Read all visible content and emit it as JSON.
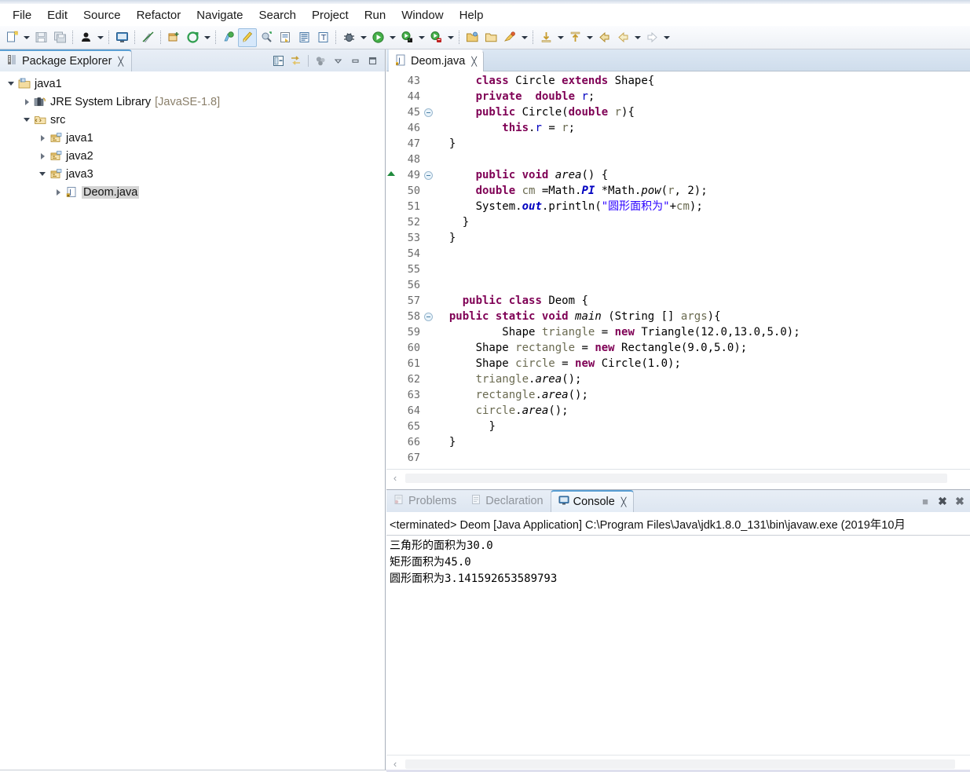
{
  "menu": {
    "items": [
      "File",
      "Edit",
      "Source",
      "Refactor",
      "Navigate",
      "Search",
      "Project",
      "Run",
      "Window",
      "Help"
    ]
  },
  "toolbar": {
    "groups": [
      {
        "buttons": [
          {
            "name": "new-wizard-icon",
            "label": "New",
            "dropdown": true
          },
          {
            "name": "save-icon",
            "label": "Save",
            "dropdown": false
          },
          {
            "name": "save-all-icon",
            "label": "Save All",
            "dropdown": false
          }
        ]
      },
      {
        "buttons": [
          {
            "name": "person-icon",
            "label": "Toggle Breakpoint",
            "dropdown": true
          }
        ]
      },
      {
        "buttons": [
          {
            "name": "console-icon",
            "label": "Open Console",
            "dropdown": false
          }
        ]
      },
      {
        "buttons": [
          {
            "name": "skip-breakpoints-icon",
            "label": "Skip All Breakpoints",
            "dropdown": false
          }
        ]
      },
      {
        "buttons": [
          {
            "name": "new-java-package-icon",
            "label": "New Java Package",
            "dropdown": false
          },
          {
            "name": "new-java-class-icon",
            "label": "New Java Class",
            "dropdown": true
          }
        ]
      },
      {
        "buttons": [
          {
            "name": "new-java-project-icon",
            "label": "New Java Project",
            "dropdown": false
          },
          {
            "name": "highlight-icon",
            "label": "Toggle Mark Occurrences",
            "dropdown": false,
            "active": true
          },
          {
            "name": "open-type-icon",
            "label": "Open Type",
            "dropdown": false
          },
          {
            "name": "externalize-strings-icon",
            "label": "Externalize Strings",
            "dropdown": false
          },
          {
            "name": "last-edit-icon",
            "label": "Last Edit Location",
            "dropdown": false
          },
          {
            "name": "next-annotation-icon",
            "label": "Next Annotation",
            "dropdown": false
          }
        ]
      },
      {
        "buttons": [
          {
            "name": "debug-icon",
            "label": "Debug",
            "dropdown": true
          },
          {
            "name": "run-icon",
            "label": "Run",
            "dropdown": true
          },
          {
            "name": "run-external-tools-icon",
            "label": "External Tools",
            "dropdown": true
          },
          {
            "name": "coverage-icon",
            "label": "Coverage",
            "dropdown": true
          }
        ]
      },
      {
        "buttons": [
          {
            "name": "open-folder-icon",
            "label": "Open Resource",
            "dropdown": false
          },
          {
            "name": "folder-icon",
            "label": "Open Task",
            "dropdown": false
          },
          {
            "name": "search-icon",
            "label": "Search",
            "dropdown": true
          }
        ]
      },
      {
        "buttons": [
          {
            "name": "previous-edit-icon",
            "label": "Previous Edit Location",
            "dropdown": true
          },
          {
            "name": "next-edit-icon",
            "label": "Next Edit Location",
            "dropdown": true
          },
          {
            "name": "back-icon",
            "label": "Back",
            "dropdown": false
          },
          {
            "name": "back-history-icon",
            "label": "Back History",
            "dropdown": true
          },
          {
            "name": "forward-icon",
            "label": "Forward",
            "dropdown": true
          }
        ]
      }
    ]
  },
  "explorer": {
    "title": "Package Explorer",
    "close_glyph": "╳",
    "tools": [
      {
        "name": "collapse-all-icon",
        "label": "Collapse All"
      },
      {
        "name": "link-with-editor-icon",
        "label": "Link with Editor"
      },
      {
        "name": "focus-on-active-task-icon",
        "label": "Focus on Active Task"
      },
      {
        "name": "view-menu-icon",
        "label": "View Menu"
      },
      {
        "name": "minimize-icon",
        "label": "Minimize"
      },
      {
        "name": "maximize-icon",
        "label": "Maximize"
      }
    ],
    "tree": [
      {
        "label": "java1",
        "suffix": "",
        "depth": 0,
        "state": "open",
        "icon": "java-project-icon",
        "selected": false
      },
      {
        "label": "JRE System Library",
        "suffix": "[JavaSE-1.8]",
        "depth": 1,
        "state": "closed",
        "icon": "jre-library-icon",
        "selected": false
      },
      {
        "label": "src",
        "suffix": "",
        "depth": 1,
        "state": "open",
        "icon": "source-folder-icon",
        "selected": false
      },
      {
        "label": "java1",
        "suffix": "",
        "depth": 2,
        "state": "closed",
        "icon": "package-icon",
        "selected": false
      },
      {
        "label": "java2",
        "suffix": "",
        "depth": 2,
        "state": "closed",
        "icon": "package-icon",
        "selected": false
      },
      {
        "label": "java3",
        "suffix": "",
        "depth": 2,
        "state": "open",
        "icon": "package-icon",
        "selected": false
      },
      {
        "label": "Deom.java",
        "suffix": "",
        "depth": 3,
        "state": "closed",
        "icon": "java-file-icon",
        "selected": true
      }
    ]
  },
  "editor": {
    "tab": {
      "label": "Deom.java",
      "icon": "java-file-icon",
      "close_glyph": "╳"
    },
    "first_line": 43,
    "lines": [
      {
        "no": 43,
        "fold": "",
        "marker": "",
        "indent": 3,
        "tokens": [
          {
            "t": "kw",
            "v": "class"
          },
          {
            "t": "pl",
            "v": " Circle "
          },
          {
            "t": "kw",
            "v": "extends"
          },
          {
            "t": "pl",
            "v": " Shape{"
          }
        ]
      },
      {
        "no": 44,
        "fold": "",
        "marker": "",
        "indent": 3,
        "tokens": [
          {
            "t": "kw",
            "v": "private"
          },
          {
            "t": "pl",
            "v": "  "
          },
          {
            "t": "kw",
            "v": "double"
          },
          {
            "t": "pl",
            "v": " "
          },
          {
            "t": "fld",
            "v": "r"
          },
          {
            "t": "pl",
            "v": ";"
          }
        ]
      },
      {
        "no": 45,
        "fold": "minus",
        "marker": "",
        "indent": 3,
        "tokens": [
          {
            "t": "kw",
            "v": "public"
          },
          {
            "t": "pl",
            "v": " Circle("
          },
          {
            "t": "kw",
            "v": "double"
          },
          {
            "t": "pl",
            "v": " "
          },
          {
            "t": "lv",
            "v": "r"
          },
          {
            "t": "pl",
            "v": "){"
          }
        ]
      },
      {
        "no": 46,
        "fold": "",
        "marker": "",
        "indent": 5,
        "tokens": [
          {
            "t": "kw",
            "v": "this"
          },
          {
            "t": "pl",
            "v": "."
          },
          {
            "t": "fld",
            "v": "r"
          },
          {
            "t": "pl",
            "v": " = "
          },
          {
            "t": "lv",
            "v": "r"
          },
          {
            "t": "pl",
            "v": ";"
          }
        ]
      },
      {
        "no": 47,
        "fold": "",
        "marker": "",
        "indent": 1,
        "tokens": [
          {
            "t": "pl",
            "v": "}"
          }
        ]
      },
      {
        "no": 48,
        "fold": "",
        "marker": "",
        "indent": 0,
        "tokens": []
      },
      {
        "no": 49,
        "fold": "minus",
        "marker": "up",
        "indent": 3,
        "tokens": [
          {
            "t": "kw",
            "v": "public"
          },
          {
            "t": "pl",
            "v": " "
          },
          {
            "t": "kw",
            "v": "void"
          },
          {
            "t": "pl",
            "v": " "
          },
          {
            "t": "mth",
            "v": "area"
          },
          {
            "t": "pl",
            "v": "() {"
          }
        ]
      },
      {
        "no": 50,
        "fold": "",
        "marker": "",
        "indent": 3,
        "tokens": [
          {
            "t": "kw",
            "v": "double"
          },
          {
            "t": "pl",
            "v": " "
          },
          {
            "t": "lv",
            "v": "cm"
          },
          {
            "t": "pl",
            "v": " =Math."
          },
          {
            "t": "sf",
            "v": "PI"
          },
          {
            "t": "pl",
            "v": " *Math."
          },
          {
            "t": "mth",
            "v": "pow"
          },
          {
            "t": "pl",
            "v": "("
          },
          {
            "t": "lv",
            "v": "r"
          },
          {
            "t": "pl",
            "v": ", 2);"
          }
        ]
      },
      {
        "no": 51,
        "fold": "",
        "marker": "",
        "indent": 3,
        "tokens": [
          {
            "t": "pl",
            "v": "System."
          },
          {
            "t": "sf",
            "v": "out"
          },
          {
            "t": "pl",
            "v": ".println("
          },
          {
            "t": "str",
            "v": "\"圆形面积为\""
          },
          {
            "t": "pl",
            "v": "+"
          },
          {
            "t": "lv",
            "v": "cm"
          },
          {
            "t": "pl",
            "v": ");"
          }
        ]
      },
      {
        "no": 52,
        "fold": "",
        "marker": "",
        "indent": 2,
        "tokens": [
          {
            "t": "pl",
            "v": "}"
          }
        ]
      },
      {
        "no": 53,
        "fold": "",
        "marker": "",
        "indent": 1,
        "tokens": [
          {
            "t": "pl",
            "v": "}"
          }
        ]
      },
      {
        "no": 54,
        "fold": "",
        "marker": "",
        "indent": 0,
        "tokens": []
      },
      {
        "no": 55,
        "fold": "",
        "marker": "",
        "indent": 0,
        "tokens": []
      },
      {
        "no": 56,
        "fold": "",
        "marker": "",
        "indent": 0,
        "tokens": []
      },
      {
        "no": 57,
        "fold": "",
        "marker": "",
        "indent": 2,
        "tokens": [
          {
            "t": "kw",
            "v": "public"
          },
          {
            "t": "pl",
            "v": " "
          },
          {
            "t": "kw",
            "v": "class"
          },
          {
            "t": "pl",
            "v": " Deom {"
          }
        ]
      },
      {
        "no": 58,
        "fold": "minus",
        "marker": "",
        "indent": 1,
        "tokens": [
          {
            "t": "kw",
            "v": "public"
          },
          {
            "t": "pl",
            "v": " "
          },
          {
            "t": "kw",
            "v": "static"
          },
          {
            "t": "pl",
            "v": " "
          },
          {
            "t": "kw",
            "v": "void"
          },
          {
            "t": "pl",
            "v": " "
          },
          {
            "t": "mth",
            "v": "main"
          },
          {
            "t": "pl",
            "v": " (String [] "
          },
          {
            "t": "lv",
            "v": "args"
          },
          {
            "t": "pl",
            "v": "){"
          }
        ]
      },
      {
        "no": 59,
        "fold": "",
        "marker": "",
        "indent": 5,
        "tokens": [
          {
            "t": "pl",
            "v": "Shape "
          },
          {
            "t": "lv",
            "v": "triangle"
          },
          {
            "t": "pl",
            "v": " = "
          },
          {
            "t": "kw",
            "v": "new"
          },
          {
            "t": "pl",
            "v": " Triangle(12.0,13.0,5.0);"
          }
        ]
      },
      {
        "no": 60,
        "fold": "",
        "marker": "",
        "indent": 3,
        "tokens": [
          {
            "t": "pl",
            "v": "Shape "
          },
          {
            "t": "lv",
            "v": "rectangle"
          },
          {
            "t": "pl",
            "v": " = "
          },
          {
            "t": "kw",
            "v": "new"
          },
          {
            "t": "pl",
            "v": " Rectangle(9.0,5.0);"
          }
        ]
      },
      {
        "no": 61,
        "fold": "",
        "marker": "",
        "indent": 3,
        "tokens": [
          {
            "t": "pl",
            "v": "Shape "
          },
          {
            "t": "lv",
            "v": "circle"
          },
          {
            "t": "pl",
            "v": " = "
          },
          {
            "t": "kw",
            "v": "new"
          },
          {
            "t": "pl",
            "v": " Circle(1.0);"
          }
        ]
      },
      {
        "no": 62,
        "fold": "",
        "marker": "",
        "indent": 3,
        "tokens": [
          {
            "t": "lv",
            "v": "triangle"
          },
          {
            "t": "pl",
            "v": "."
          },
          {
            "t": "mth",
            "v": "area"
          },
          {
            "t": "pl",
            "v": "();"
          }
        ]
      },
      {
        "no": 63,
        "fold": "",
        "marker": "",
        "indent": 3,
        "tokens": [
          {
            "t": "lv",
            "v": "rectangle"
          },
          {
            "t": "pl",
            "v": "."
          },
          {
            "t": "mth",
            "v": "area"
          },
          {
            "t": "pl",
            "v": "();"
          }
        ]
      },
      {
        "no": 64,
        "fold": "",
        "marker": "",
        "indent": 3,
        "tokens": [
          {
            "t": "lv",
            "v": "circle"
          },
          {
            "t": "pl",
            "v": "."
          },
          {
            "t": "mth",
            "v": "area"
          },
          {
            "t": "pl",
            "v": "();"
          }
        ]
      },
      {
        "no": 65,
        "fold": "",
        "marker": "",
        "indent": 4,
        "tokens": [
          {
            "t": "pl",
            "v": "}"
          }
        ]
      },
      {
        "no": 66,
        "fold": "",
        "marker": "",
        "indent": 1,
        "tokens": [
          {
            "t": "pl",
            "v": "}"
          }
        ]
      },
      {
        "no": 67,
        "fold": "",
        "marker": "",
        "indent": 0,
        "tokens": []
      }
    ]
  },
  "console": {
    "tabs": [
      {
        "label": "Problems",
        "icon": "problems-icon",
        "active": false,
        "closeable": false
      },
      {
        "label": "Declaration",
        "icon": "declaration-icon",
        "active": false,
        "closeable": false
      },
      {
        "label": "Console",
        "icon": "console-icon",
        "active": true,
        "closeable": true
      }
    ],
    "close_glyph": "╳",
    "tools": [
      {
        "name": "terminate-icon",
        "label": "Terminate",
        "glyph": "■"
      },
      {
        "name": "remove-launch-icon",
        "label": "Remove Launch",
        "glyph": "✖"
      },
      {
        "name": "remove-all-icon",
        "label": "Remove All Terminated",
        "glyph": "✖"
      }
    ],
    "launch_line": "<terminated> Deom [Java Application] C:\\Program Files\\Java\\jdk1.8.0_131\\bin\\javaw.exe (2019年10月",
    "output": [
      "三角形的面积为30.0",
      "矩形面积为45.0",
      "圆形面积为3.141592653589793"
    ]
  },
  "scrollbars": {
    "left_arrow_glyph": "‹"
  }
}
